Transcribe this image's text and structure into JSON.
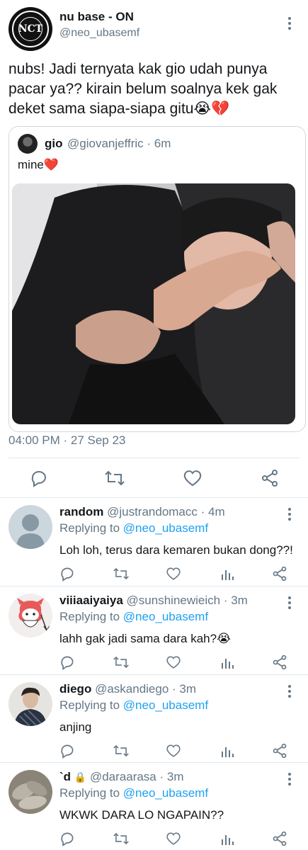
{
  "main_tweet": {
    "name": "nu base - ON",
    "handle": "@neo_ubasemf",
    "avatar_label": "NCT",
    "text": "nubs! Jadi ternyata kak gio udah punya pacar ya?? kirain belum soalnya kek gak deket sama siapa-siapa gitu😭💔",
    "timestamp": "04:00 PM · 27 Sep 23",
    "quote": {
      "name": "gio",
      "handle": "@giovanjeffric · 6m",
      "text": "mine❤️"
    }
  },
  "replies": [
    {
      "name": "random",
      "handle": "@justrandomacc · 4m",
      "replying_prefix": "Replying to ",
      "replying_to": "@neo_ubasemf",
      "text": "Loh loh, terus dara kemaren bukan dong??!"
    },
    {
      "name": "viiiaaiyaiya",
      "handle": "@sunshinewieich · 3m",
      "replying_prefix": "Replying to ",
      "replying_to": "@neo_ubasemf",
      "text": "lahh gak jadi sama dara kah?😭"
    },
    {
      "name": "diego",
      "handle": "@askandiego · 3m",
      "replying_prefix": "Replying to ",
      "replying_to": "@neo_ubasemf",
      "text": "anjing"
    },
    {
      "name": "`d",
      "lock": "🔒",
      "handle": "@daraarasa · 3m",
      "replying_prefix": "Replying to ",
      "replying_to": "@neo_ubasemf",
      "text": "WKWK DARA LO NGAPAIN??"
    }
  ],
  "colors": {
    "text": "#14171a",
    "secondary": "#657786",
    "link": "#1da1f2",
    "divider": "#e1e8ed",
    "heart": "#e0245e"
  },
  "icons": [
    "reply-icon",
    "retweet-icon",
    "like-icon",
    "share-icon",
    "views-icon",
    "more-icon",
    "lock-icon"
  ]
}
